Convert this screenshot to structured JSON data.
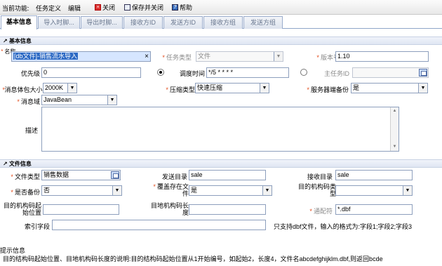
{
  "toolbar": {
    "current_function": "当前功能:",
    "task_def": "任务定义",
    "edit": "编辑",
    "close": "关闭",
    "save_close": "保存并关闭",
    "help": "帮助"
  },
  "tabs": [
    "基本信息",
    "导入时脚...",
    "导出时脚...",
    "接收方ID",
    "发送方ID",
    "接收方组",
    "发送方组"
  ],
  "sections": {
    "basic": "基本信息",
    "file": "文件信息"
  },
  "basic": {
    "name_label": "名称",
    "name_value": "[db文件]-销售流水导入",
    "task_type_label": "任务类型",
    "task_type_value": "文件",
    "version_label": "版本号",
    "version_value": "1.10",
    "priority_label": "优先级",
    "priority_value": "0",
    "schedule_label": "调度时间",
    "schedule_value": "*/5 * * * *",
    "main_task_label": "主任务ID",
    "main_task_value": "",
    "msg_size_label": "消息体包大小",
    "msg_size_value": "2000K",
    "compress_label": "压缩类型",
    "compress_value": "快速压缩",
    "server_backup_label": "服务器端备份",
    "server_backup_value": "是",
    "msg_domain_label": "消息域",
    "msg_domain_value": "JavaBean",
    "desc_label": "描述"
  },
  "file": {
    "file_type_label": "文件类型",
    "file_type_value": "销售数据",
    "send_dir_label": "发送目录",
    "send_dir_value": "sale",
    "recv_dir_label": "接收目录",
    "recv_dir_value": "sale",
    "backup_label": "是否备份",
    "backup_value": "否",
    "overwrite_label_1": "覆盖存在文",
    "overwrite_label_2": "件",
    "overwrite_value": "是",
    "target_type_label_1": "目的机构码类",
    "target_type_label_2": "型",
    "target_type_value": "",
    "target_start_label_1": "目的机构码起",
    "target_start_label_2": "始位置",
    "target_start_value": "",
    "target_len_label_1": "目地机构码长",
    "target_len_label_2": "度",
    "target_len_value": "",
    "wildcard_label": "通配符",
    "wildcard_value": "*.dbf",
    "index_label": "索引字段",
    "index_value": "",
    "dbf_note": "只支持dbf文件，输入的格式为:字段1;字段2;字段3"
  },
  "tips": {
    "title": "提示信息",
    "text": "目的结构码起始位置、目地机构码长度的说明:目的结构码起始位置从1开始编号，如起始2，长度4，文件名abcdefghijklm.dbf,则返回bcde"
  },
  "colors": {
    "required": "#e24c1c",
    "tab_border": "#9aaccc",
    "section_bg": "#dfe6f3",
    "selection": "#2c69c4"
  }
}
